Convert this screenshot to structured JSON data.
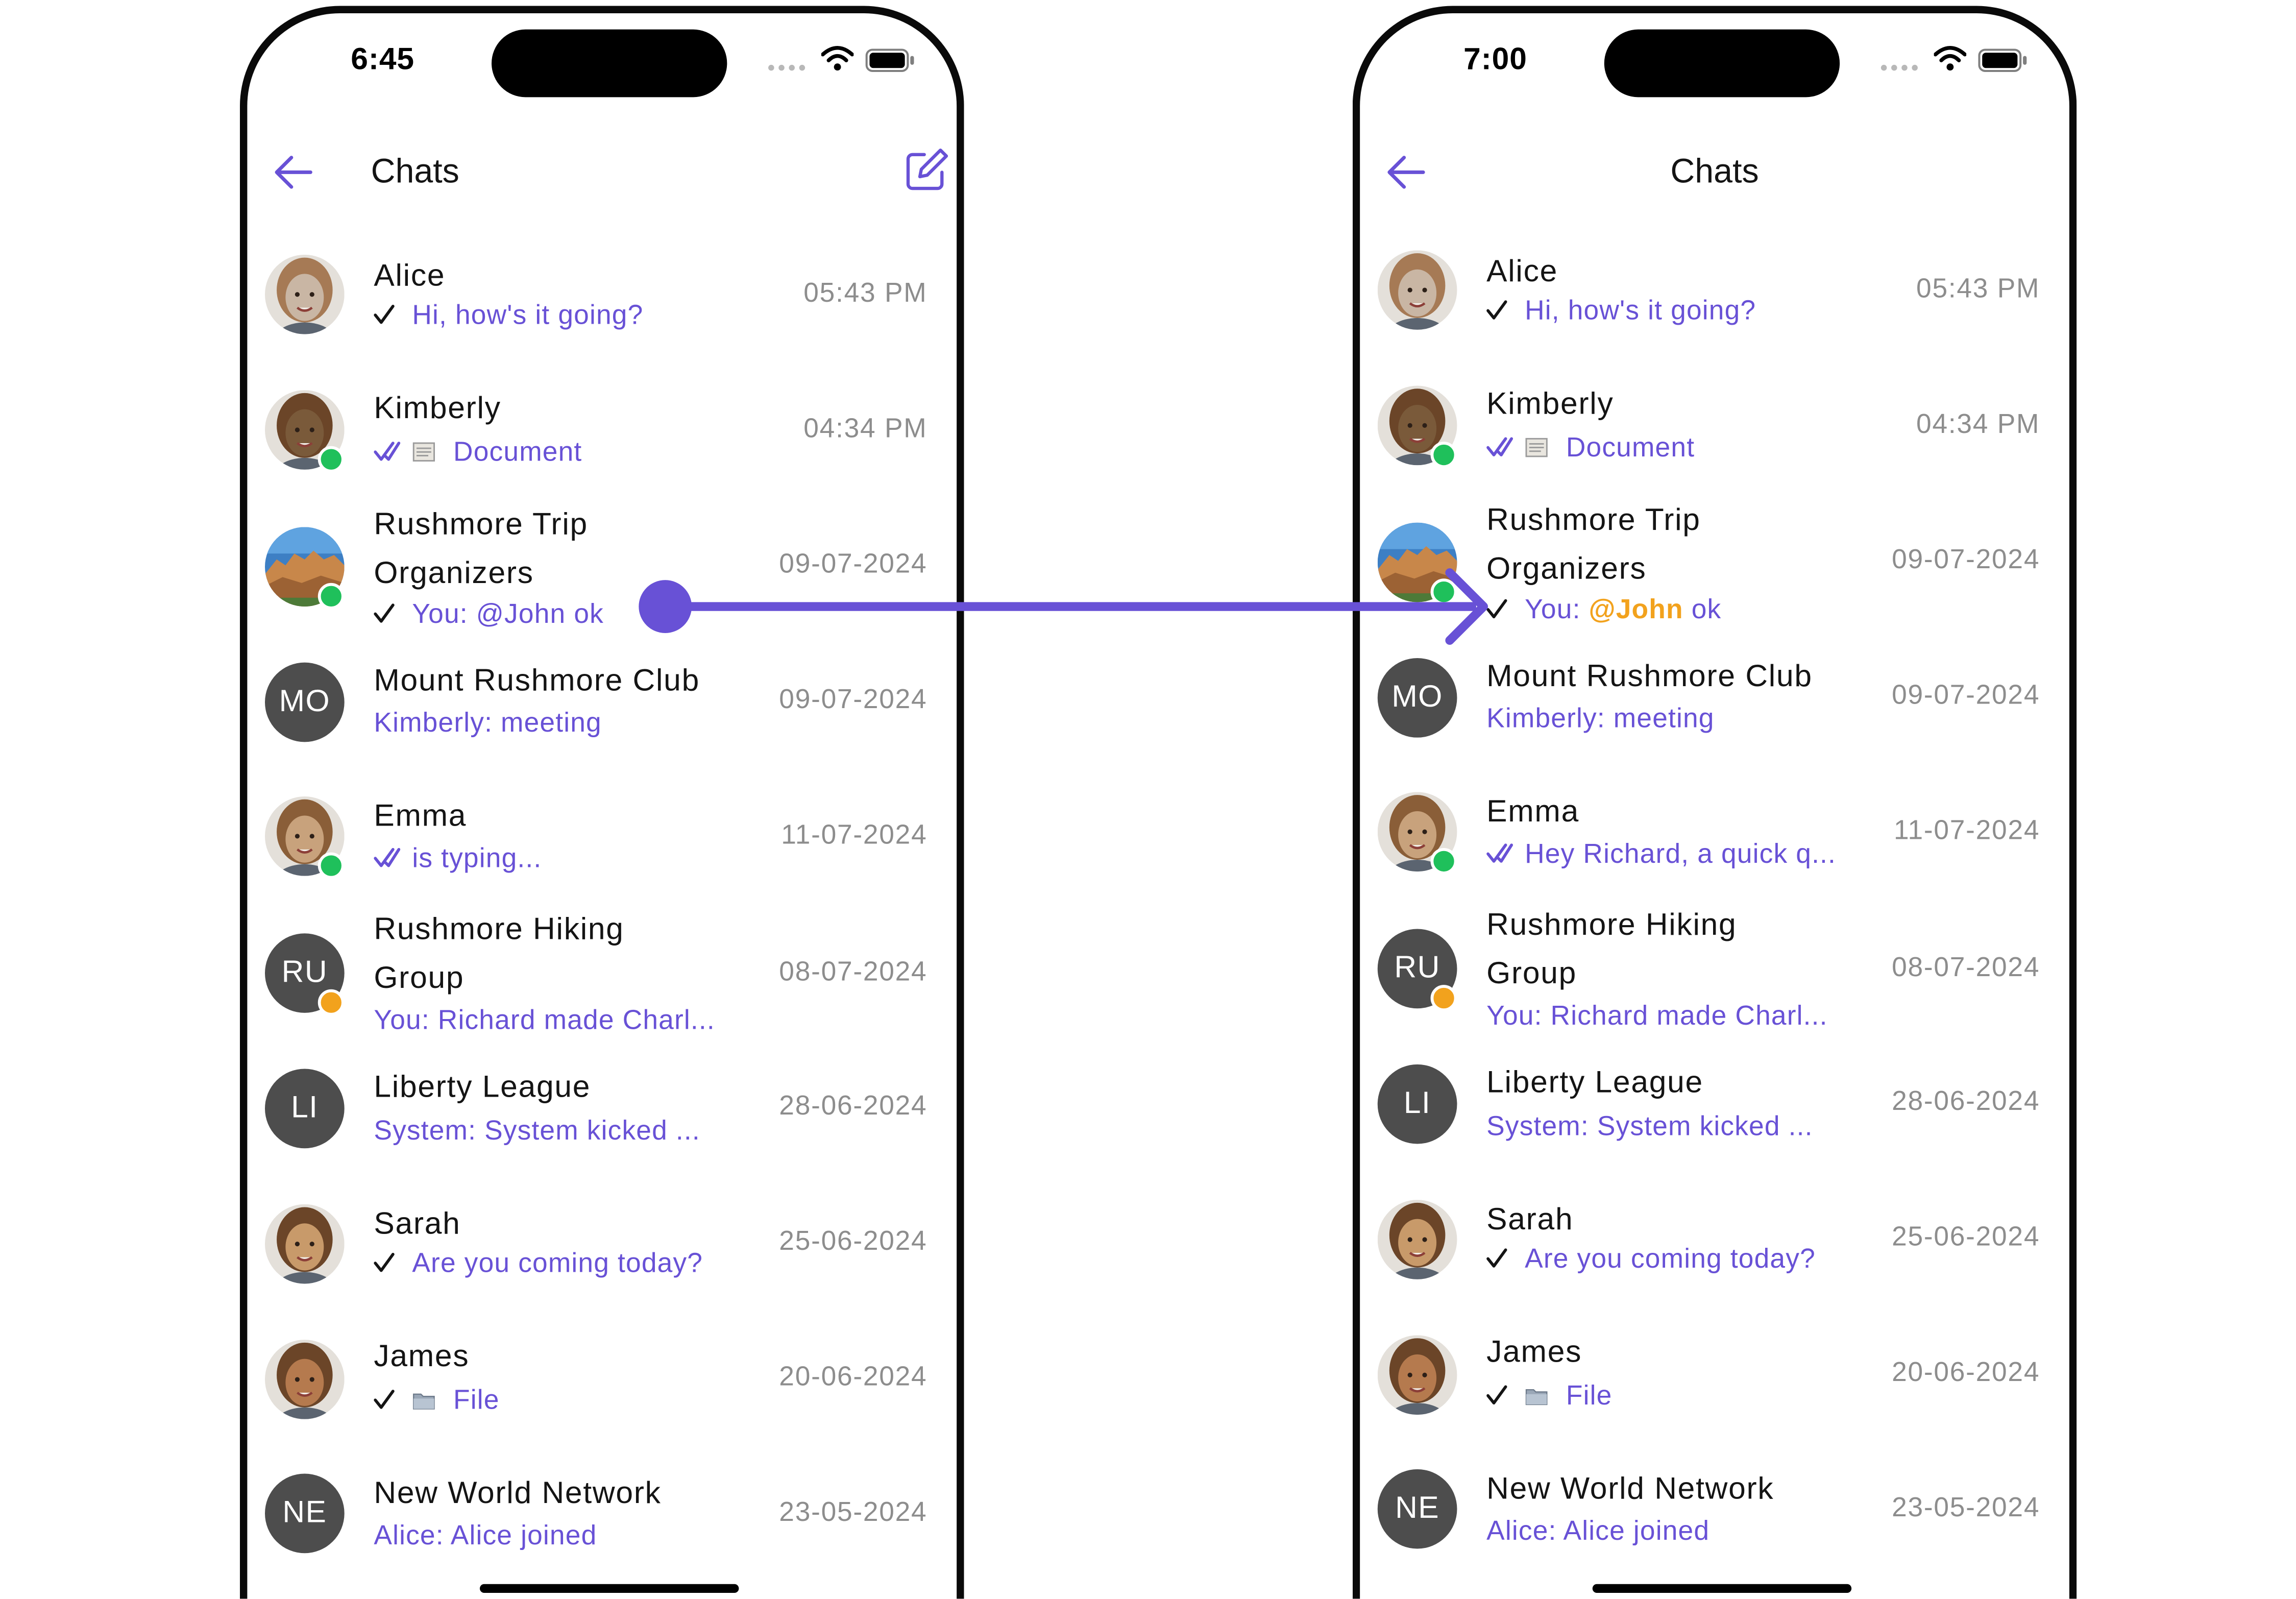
{
  "screens": [
    {
      "status_time": "6:45",
      "header_title": "Chats",
      "chats": [
        {
          "name": "Alice",
          "preview": "Hi, how's it going?",
          "time": "05:43 PM",
          "receipt": "sent",
          "avatar": "photo",
          "avatar_color": "#c9b6a4"
        },
        {
          "name": "Kimberly",
          "preview": "Document",
          "time": "04:34 PM",
          "receipt": "read",
          "attachment": "document",
          "avatar": "photo",
          "avatar_color": "#7a5a3a",
          "status": "online"
        },
        {
          "name": "Rushmore Trip Organizers",
          "preview_prefix": "You: ",
          "preview_mention": "@John",
          "preview_suffix": " ok",
          "time": "09-07-2024",
          "receipt": "sent",
          "avatar": "landscape",
          "status": "group-public"
        },
        {
          "name": "Mount Rushmore Club",
          "preview": "Kimberly: meeting",
          "time": "09-07-2024",
          "avatar": "initials",
          "initials": "MO"
        },
        {
          "name": "Emma",
          "preview": "is typing...",
          "time": "11-07-2024",
          "receipt": "read",
          "avatar": "photo",
          "avatar_color": "#c8a27c",
          "status": "online"
        },
        {
          "name": "Rushmore Hiking Group",
          "preview": "You: Richard made Charl...",
          "time": "08-07-2024",
          "avatar": "initials",
          "initials": "RU",
          "status": "locked"
        },
        {
          "name": "Liberty League",
          "preview": "System: System kicked ...",
          "time": "28-06-2024",
          "avatar": "initials",
          "initials": "LI"
        },
        {
          "name": "Sarah",
          "preview": "Are you coming today?",
          "time": "25-06-2024",
          "receipt": "sent",
          "avatar": "photo",
          "avatar_color": "#c89a6a"
        },
        {
          "name": "James",
          "preview": "File",
          "time": "20-06-2024",
          "receipt": "sent",
          "attachment": "file",
          "avatar": "photo",
          "avatar_color": "#b57a4e"
        },
        {
          "name": "New World Network",
          "preview": "Alice: Alice joined",
          "time": "23-05-2024",
          "avatar": "initials",
          "initials": "NE"
        }
      ]
    },
    {
      "status_time": "7:00",
      "header_title": "Chats",
      "chats": [
        {
          "name": "Alice",
          "preview": "Hi, how's it going?",
          "time": "05:43 PM",
          "receipt": "sent",
          "avatar": "photo",
          "avatar_color": "#c9b6a4"
        },
        {
          "name": "Kimberly",
          "preview": "Document",
          "time": "04:34 PM",
          "receipt": "read",
          "attachment": "document",
          "avatar": "photo",
          "avatar_color": "#7a5a3a",
          "status": "online"
        },
        {
          "name": "Rushmore Trip Organizers",
          "preview_prefix": "You: ",
          "preview_mention": "@John",
          "preview_suffix": " ok",
          "time": "09-07-2024",
          "receipt": "sent",
          "avatar": "landscape",
          "status": "group-public"
        },
        {
          "name": "Mount Rushmore Club",
          "preview": "Kimberly: meeting",
          "time": "09-07-2024",
          "avatar": "initials",
          "initials": "MO"
        },
        {
          "name": "Emma",
          "preview": "Hey Richard, a quick q...",
          "time": "11-07-2024",
          "receipt": "read",
          "avatar": "photo",
          "avatar_color": "#c8a27c",
          "status": "online"
        },
        {
          "name": "Rushmore Hiking Group",
          "preview": "You: Richard made Charl...",
          "time": "08-07-2024",
          "avatar": "initials",
          "initials": "RU",
          "status": "locked"
        },
        {
          "name": "Liberty League",
          "preview": "System: System kicked ...",
          "time": "28-06-2024",
          "avatar": "initials",
          "initials": "LI"
        },
        {
          "name": "Sarah",
          "preview": "Are you coming today?",
          "time": "25-06-2024",
          "receipt": "sent",
          "avatar": "photo",
          "avatar_color": "#c89a6a"
        },
        {
          "name": "James",
          "preview": "File",
          "time": "20-06-2024",
          "receipt": "sent",
          "attachment": "file",
          "avatar": "photo",
          "avatar_color": "#b57a4e"
        },
        {
          "name": "New World Network",
          "preview": "Alice: Alice joined",
          "time": "23-05-2024",
          "avatar": "initials",
          "initials": "NE"
        }
      ]
    }
  ],
  "theme": {
    "accent": "#6851d6",
    "mention": "#f2a21d",
    "online": "#1fc05b",
    "avatar_bg": "#4d4d4d",
    "muted_text": "#8d8d8d"
  }
}
